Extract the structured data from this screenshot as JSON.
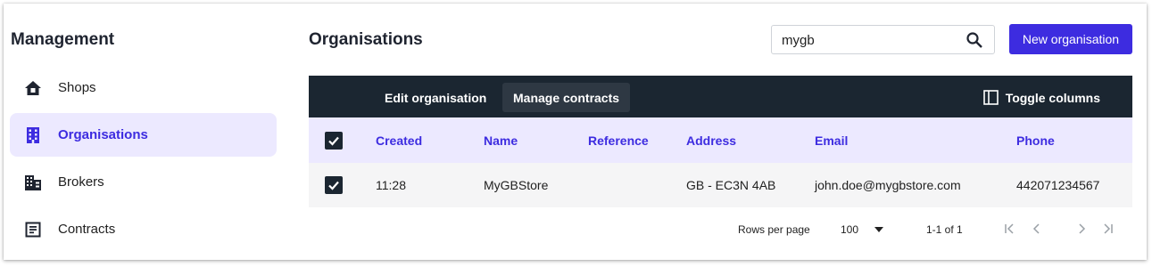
{
  "sidebar": {
    "title": "Management",
    "items": [
      {
        "label": "Shops",
        "icon": "shop-home-icon"
      },
      {
        "label": "Organisations",
        "icon": "building-icon"
      },
      {
        "label": "Brokers",
        "icon": "broker-building-icon"
      },
      {
        "label": "Contracts",
        "icon": "document-icon"
      }
    ]
  },
  "header": {
    "title": "Organisations",
    "search_value": "mygb",
    "new_button": "New organisation"
  },
  "toolbar": {
    "edit": "Edit organisation",
    "manage": "Manage contracts",
    "toggle": "Toggle columns"
  },
  "table": {
    "columns": [
      "Created",
      "Name",
      "Reference",
      "Address",
      "Email",
      "Phone"
    ],
    "rows": [
      {
        "created": "11:28",
        "name": "MyGBStore",
        "reference": "",
        "address": "GB - EC3N 4AB",
        "email": "john.doe@mygbstore.com",
        "phone": "442071234567",
        "selected": true
      }
    ]
  },
  "pagination": {
    "rows_per_page_label": "Rows per page",
    "rows_per_page": "100",
    "range": "1-1 of 1"
  },
  "colors": {
    "accent": "#3d2ce0",
    "active_bg": "#ece9ff",
    "toolbar_bg": "#1b2631"
  }
}
